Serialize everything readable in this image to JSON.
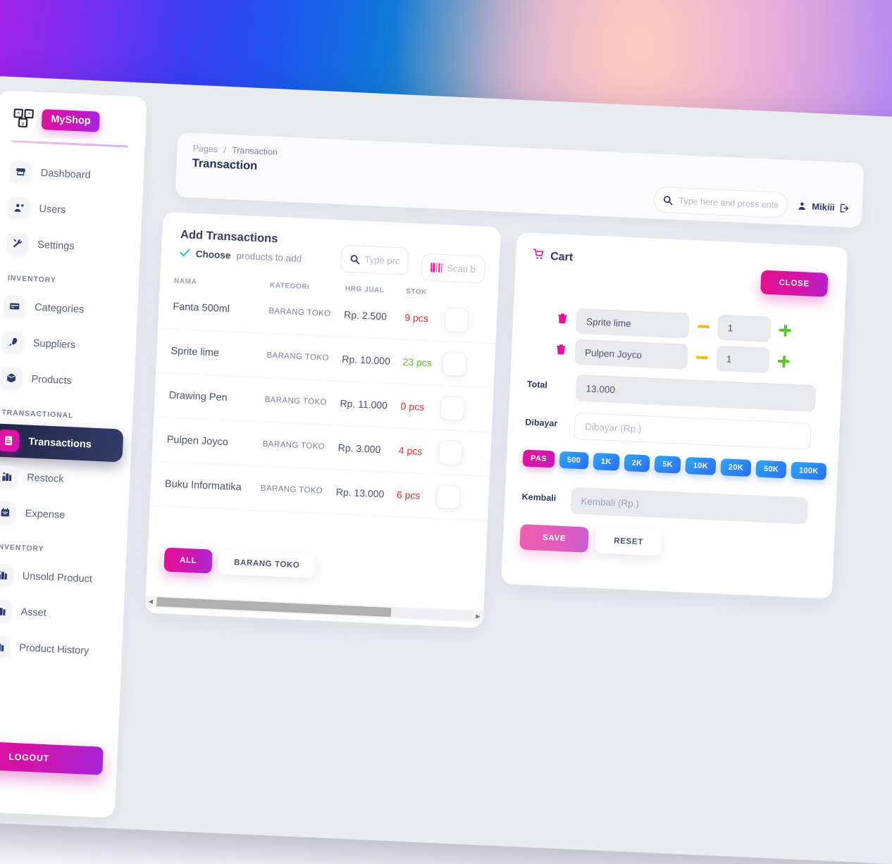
{
  "brand": {
    "name": "MyShop",
    "logo_icon": "blocks-logo-icon"
  },
  "sidebar": {
    "groups": [
      {
        "label": "",
        "items": [
          {
            "label": "Dashboard",
            "icon": "store-icon",
            "active": false
          },
          {
            "label": "Users",
            "icon": "users-icon",
            "active": false
          },
          {
            "label": "Settings",
            "icon": "tools-icon",
            "active": false
          }
        ]
      },
      {
        "label": "INVENTORY",
        "items": [
          {
            "label": "Categories",
            "icon": "card-icon",
            "active": false
          },
          {
            "label": "Suppliers",
            "icon": "rocket-icon",
            "active": false
          },
          {
            "label": "Products",
            "icon": "box-icon",
            "active": false
          }
        ]
      },
      {
        "label": "TRANSACTIONAL",
        "items": [
          {
            "label": "Transactions",
            "icon": "receipt-icon",
            "active": true
          },
          {
            "label": "Restock",
            "icon": "chart-bar-icon",
            "active": false
          },
          {
            "label": "Expense",
            "icon": "calendar-icon",
            "active": false
          }
        ]
      },
      {
        "label": "INVENTORY",
        "items": [
          {
            "label": "Unsold Product",
            "icon": "chart-bar-icon",
            "active": false
          },
          {
            "label": "Asset",
            "icon": "chart-bar-icon",
            "active": false
          },
          {
            "label": "Product History",
            "icon": "chart-bar-icon",
            "active": false
          }
        ]
      }
    ],
    "logout_label": "LOGOUT"
  },
  "topbar": {
    "breadcrumb_root": "Pages",
    "breadcrumb_sep": "/",
    "breadcrumb_current": "Transaction",
    "page_title": "Transaction",
    "search_placeholder": "Type here and press enter",
    "search_value": "",
    "search_icon": "search-icon",
    "user_name": "Mikiii",
    "user_icon": "user-icon",
    "logout_icon": "signout-icon"
  },
  "add_panel": {
    "title": "Add Transactions",
    "subtitle_bold": "Choose",
    "subtitle_rest": "products to add",
    "check_icon": "check-icon",
    "product_search_placeholder": "Type product name",
    "product_search_value": "",
    "scan_placeholder": "Scan barcode",
    "scan_value": "",
    "scan_icon": "barcode-icon",
    "columns": [
      "NAMA",
      "KATEGORI",
      "HRG JUAL",
      "STOK",
      ""
    ],
    "rows": [
      {
        "nama": "Fanta 500ml",
        "kategori": "BARANG TOKO",
        "harga": "Rp. 2.500",
        "stok": "9 pcs",
        "stok_state": "low"
      },
      {
        "nama": "Sprite lime",
        "kategori": "BARANG TOKO",
        "harga": "Rp. 10.000",
        "stok": "23 pcs",
        "stok_state": "ok"
      },
      {
        "nama": "Drawing Pen",
        "kategori": "BARANG TOKO",
        "harga": "Rp. 11.000",
        "stok": "0 pcs",
        "stok_state": "low"
      },
      {
        "nama": "Pulpen Joyco",
        "kategori": "BARANG TOKO",
        "harga": "Rp. 3.000",
        "stok": "4 pcs",
        "stok_state": "low"
      },
      {
        "nama": "Buku Informatika",
        "kategori": "BARANG TOKO",
        "harga": "Rp. 13.000",
        "stok": "6 pcs",
        "stok_state": "low"
      }
    ],
    "filters": [
      {
        "label": "ALL",
        "active": true
      },
      {
        "label": "BARANG TOKO",
        "active": false
      }
    ]
  },
  "cart": {
    "title": "Cart",
    "cart_icon": "cart-icon",
    "close_label": "CLOSE",
    "items": [
      {
        "name": "Sprite lime",
        "qty": "1",
        "trash_icon": "trash-icon"
      },
      {
        "name": "Pulpen Joyco",
        "qty": "1",
        "trash_icon": "trash-icon"
      }
    ],
    "total_label": "Total",
    "total_value": "13.000",
    "dibayar_label": "Dibayar",
    "dibayar_placeholder": "Dibayar (Rp.)",
    "dibayar_value": "",
    "kembali_label": "Kembali",
    "kembali_placeholder": "Kembali (Rp.)",
    "kembali_value": "",
    "denominations": [
      {
        "label": "PAS",
        "kind": "pas"
      },
      {
        "label": "500",
        "kind": "num"
      },
      {
        "label": "1K",
        "kind": "num"
      },
      {
        "label": "2K",
        "kind": "num"
      },
      {
        "label": "5K",
        "kind": "num"
      },
      {
        "label": "10K",
        "kind": "num"
      },
      {
        "label": "20K",
        "kind": "num"
      },
      {
        "label": "50K",
        "kind": "num"
      },
      {
        "label": "100K",
        "kind": "num"
      }
    ],
    "save_label": "SAVE",
    "reset_label": "RESET"
  },
  "colors": {
    "accent_pink": "#e50f96",
    "accent_purple": "#a728d9",
    "blue": "#2a6ef0",
    "green": "#5fc42a",
    "red": "#f03030",
    "yellow": "#f5b818",
    "dark_nav": "#1f2547"
  }
}
